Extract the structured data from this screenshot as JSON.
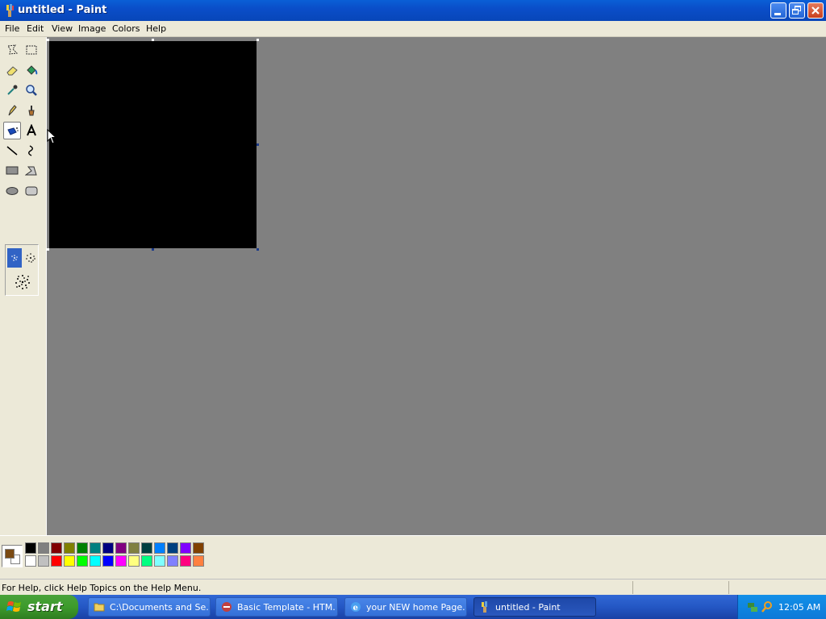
{
  "window": {
    "title": "untitled - Paint"
  },
  "menu": [
    "File",
    "Edit",
    "View",
    "Image",
    "Colors",
    "Help"
  ],
  "tools": [
    "free-form-select",
    "select",
    "eraser",
    "fill-with-color",
    "pick-color",
    "magnifier",
    "pencil",
    "brush",
    "airbrush",
    "text",
    "line",
    "curve",
    "rectangle",
    "polygon",
    "ellipse",
    "rounded-rectangle"
  ],
  "active_tool": "airbrush",
  "palette": {
    "foreground": "#7a4a12",
    "background": "#ffffff",
    "colors_top": [
      "#000000",
      "#808080",
      "#800000",
      "#808000",
      "#008000",
      "#008080",
      "#000080",
      "#800080",
      "#808040",
      "#004040",
      "#0080ff",
      "#004080",
      "#8000ff",
      "#804000"
    ],
    "colors_bottom": [
      "#ffffff",
      "#c0c0c0",
      "#ff0000",
      "#ffff00",
      "#00ff00",
      "#00ffff",
      "#0000ff",
      "#ff00ff",
      "#ffff80",
      "#00ff80",
      "#80ffff",
      "#8080ff",
      "#ff0080",
      "#ff8040"
    ]
  },
  "canvas": {
    "fill": "#000000"
  },
  "status": {
    "text": "For Help, click Help Topics on the Help Menu."
  },
  "taskbar": {
    "start_label": "start",
    "tasks": [
      {
        "label": "C:\\Documents and Se...",
        "icon": "folder-icon"
      },
      {
        "label": "Basic Template - HTM...",
        "icon": "html-editor-icon"
      },
      {
        "label": "your NEW home Page...",
        "icon": "internet-explorer-icon"
      },
      {
        "label": "untitled - Paint",
        "icon": "paint-icon"
      }
    ],
    "clock": "12:05 AM"
  }
}
